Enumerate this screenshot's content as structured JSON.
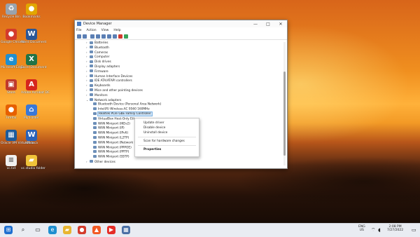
{
  "desktop": {
    "icons": [
      {
        "label": "Recycle Bin",
        "icon": "recycle-bin-icon",
        "color": "#9aa3ad",
        "glyph": "♻"
      },
      {
        "label": "Bookmarks",
        "icon": "chrome-icon",
        "color": "#e2a600",
        "glyph": "●"
      },
      {
        "label": "Google Chrome",
        "icon": "chrome-icon",
        "color": "#d33b2c",
        "glyph": "●"
      },
      {
        "label": "Word Document",
        "icon": "word-icon",
        "color": "#2b5797",
        "glyph": "W"
      },
      {
        "label": "Microsoft Edge",
        "icon": "edge-icon",
        "color": "#1f8fd0",
        "glyph": "e"
      },
      {
        "label": "Excel Document",
        "icon": "excel-icon",
        "color": "#217346",
        "glyph": "X"
      },
      {
        "label": "Store",
        "icon": "store-icon",
        "color": "#c0392b",
        "glyph": "▣"
      },
      {
        "label": "Adobe Acrobat DC",
        "icon": "acrobat-icon",
        "color": "#d6261d",
        "glyph": "A"
      },
      {
        "label": "Firefox",
        "icon": "firefox-icon",
        "color": "#e66000",
        "glyph": "●"
      },
      {
        "label": "My Folder",
        "icon": "folder-icon",
        "color": "#3a78d8",
        "glyph": "⌂"
      },
      {
        "label": "Oracle VM VirtualBox",
        "icon": "virtualbox-icon",
        "color": "#1c5b9c",
        "glyph": "▦"
      },
      {
        "label": "KMdoca",
        "icon": "file-icon",
        "color": "#2a62b7",
        "glyph": "W"
      },
      {
        "label": "vc.txt",
        "icon": "text-file-icon",
        "color": "#f0f0f0",
        "glyph": "≡"
      },
      {
        "label": "vc.studio folder",
        "icon": "folder-icon",
        "color": "#f0c43a",
        "glyph": "▰"
      }
    ]
  },
  "window": {
    "title": "Device Manager",
    "controls": {
      "minimize": "—",
      "maximize": "□",
      "close": "✕"
    },
    "menu": [
      "File",
      "Action",
      "View",
      "Help"
    ],
    "toolbar_icons": [
      "back-icon",
      "forward-icon",
      "properties-icon",
      "help-icon",
      "scan-icon",
      "monitor-icon",
      "update-driver-icon",
      "remove-icon",
      "enable-icon"
    ]
  },
  "tree": [
    {
      "label": "Batteries",
      "level": 1,
      "twisty": "›"
    },
    {
      "label": "Bluetooth",
      "level": 1,
      "twisty": "›"
    },
    {
      "label": "Cameras",
      "level": 1,
      "twisty": "›"
    },
    {
      "label": "Computer",
      "level": 1,
      "twisty": "›"
    },
    {
      "label": "Disk drives",
      "level": 1,
      "twisty": "›"
    },
    {
      "label": "Display adapters",
      "level": 1,
      "twisty": "›"
    },
    {
      "label": "Firmware",
      "level": 1,
      "twisty": "›"
    },
    {
      "label": "Human Interface Devices",
      "level": 1,
      "twisty": "›"
    },
    {
      "label": "IDE ATA/ATAPI controllers",
      "level": 1,
      "twisty": "›"
    },
    {
      "label": "Keyboards",
      "level": 1,
      "twisty": "›"
    },
    {
      "label": "Mice and other pointing devices",
      "level": 1,
      "twisty": "›"
    },
    {
      "label": "Monitors",
      "level": 1,
      "twisty": "›"
    },
    {
      "label": "Network adapters",
      "level": 1,
      "twisty": "⌄"
    },
    {
      "label": "Bluetooth Device (Personal Area Network)",
      "level": 2,
      "twisty": ""
    },
    {
      "label": "Intel(R) Wireless-AC 9560 160MHz",
      "level": 2,
      "twisty": ""
    },
    {
      "label": "Realtek PCIe GbE Family Controller",
      "level": 2,
      "twisty": "",
      "selected": true
    },
    {
      "label": "VirtualBox Host-Only Ethe",
      "level": 2,
      "twisty": ""
    },
    {
      "label": "WAN Miniport (IKEv2)",
      "level": 2,
      "twisty": ""
    },
    {
      "label": "WAN Miniport (IP)",
      "level": 2,
      "twisty": ""
    },
    {
      "label": "WAN Miniport (IPv6)",
      "level": 2,
      "twisty": ""
    },
    {
      "label": "WAN Miniport (L2TP)",
      "level": 2,
      "twisty": ""
    },
    {
      "label": "WAN Miniport (Network M",
      "level": 2,
      "twisty": ""
    },
    {
      "label": "WAN Miniport (PPPOE)",
      "level": 2,
      "twisty": ""
    },
    {
      "label": "WAN Miniport (PPTP)",
      "level": 2,
      "twisty": ""
    },
    {
      "label": "WAN Miniport (SSTP)",
      "level": 2,
      "twisty": ""
    },
    {
      "label": "Other devices",
      "level": 1,
      "twisty": "›"
    }
  ],
  "context_menu": {
    "items": [
      "Update driver",
      "Disable device",
      "Uninstall device"
    ],
    "scan": "Scan for hardware changes",
    "properties": "Properties"
  },
  "taskbar": {
    "apps": [
      {
        "icon": "windows-start-icon",
        "color": "#1f6fd0",
        "glyph": "⊞"
      },
      {
        "icon": "search-icon",
        "color": "#3b3b3b",
        "glyph": "⌕"
      },
      {
        "icon": "task-view-icon",
        "color": "#3b3b3b",
        "glyph": "▭"
      },
      {
        "icon": "edge-icon",
        "color": "#1f8fd0",
        "glyph": "e"
      },
      {
        "icon": "file-explorer-icon",
        "color": "#e8b531",
        "glyph": "▰"
      },
      {
        "icon": "chrome-icon",
        "color": "#d33b2c",
        "glyph": "●"
      },
      {
        "icon": "brave-icon",
        "color": "#f25a24",
        "glyph": "▲"
      },
      {
        "icon": "youtube-icon",
        "color": "#e52d27",
        "glyph": "▶"
      },
      {
        "icon": "device-manager-icon",
        "color": "#4a6fa5",
        "glyph": "▦"
      }
    ],
    "language": "ENG",
    "region": "US",
    "time": "2:08 PM",
    "date": "7/27/2022"
  }
}
